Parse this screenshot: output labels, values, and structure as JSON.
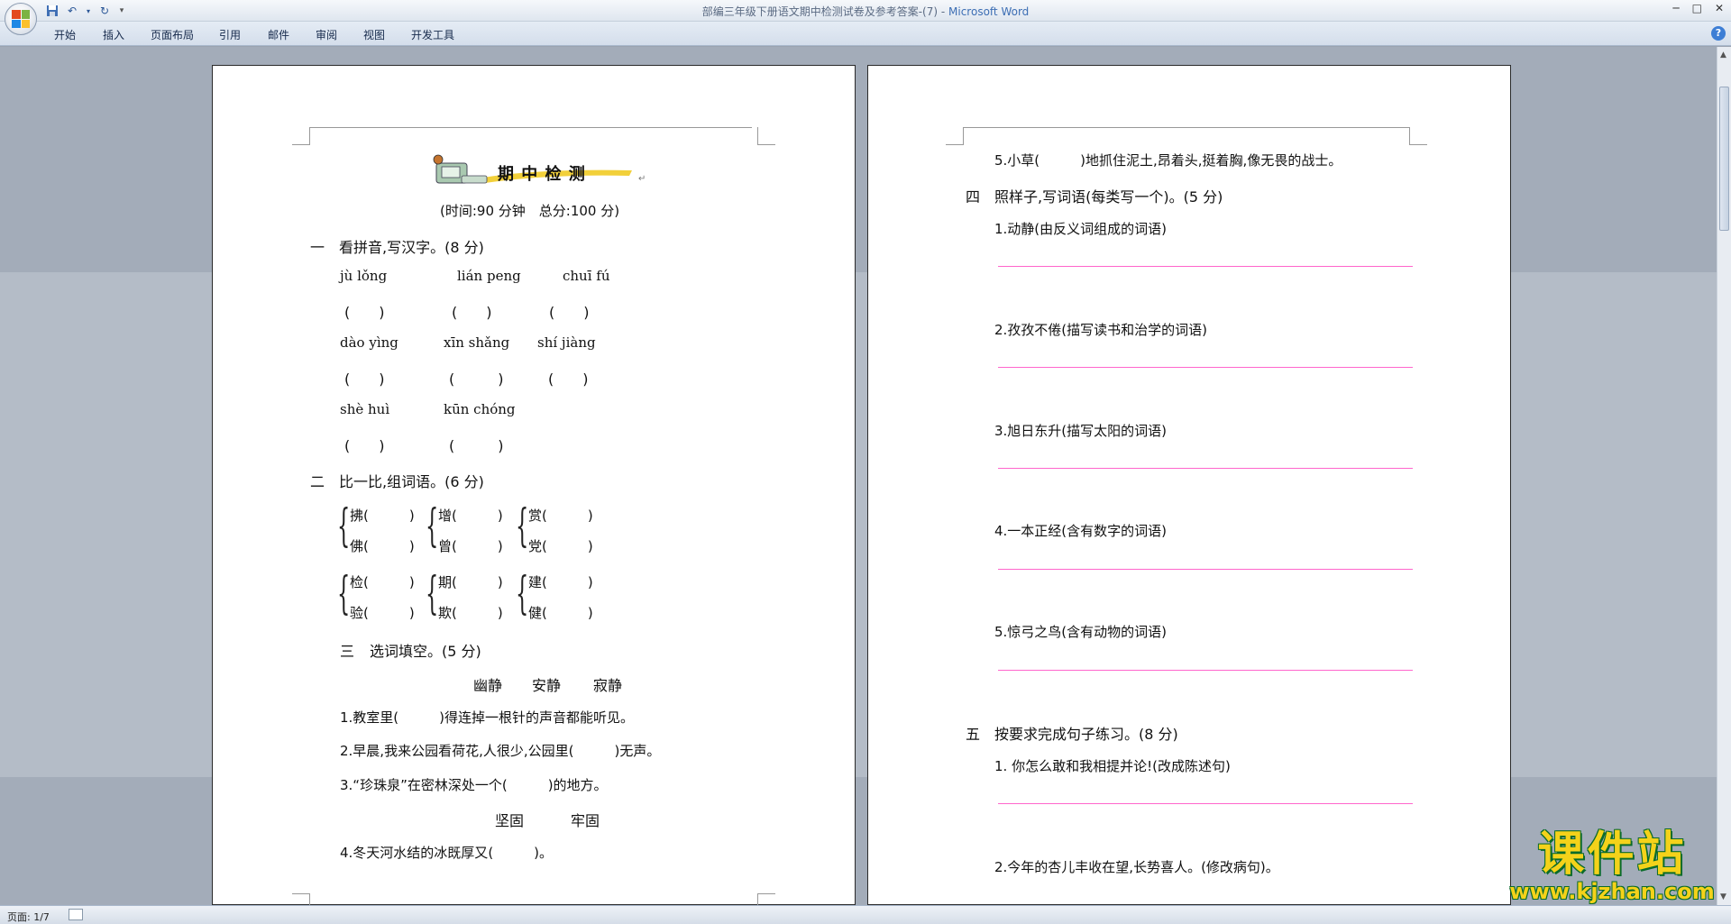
{
  "window": {
    "title": "部编三年级下册语文期中检测试卷及参考答案-(7)",
    "app": "Microsoft Word",
    "separator": " - "
  },
  "ribbon": {
    "tabs": [
      "开始",
      "插入",
      "页面布局",
      "引用",
      "邮件",
      "审阅",
      "视图",
      "开发工具"
    ],
    "help": "?"
  },
  "status": {
    "page": "页面: 1/7"
  },
  "watermark": {
    "cn": "课件站",
    "url": "www.kjzhan.com"
  },
  "colors": {
    "answer_line": "#ff66cc",
    "watermark": "#f4d21a",
    "watermark_outline": "#0a6b2a"
  },
  "page1": {
    "title": "期 中 检 测",
    "subtitle": "(时间:90 分钟　总分:100 分)",
    "s1": {
      "num": "一",
      "head": "看拼音,写汉字。(8 分)"
    },
    "pinyin_r1": [
      "jù lǒng",
      "lián peng",
      "chuī  fú"
    ],
    "blank_r1": [
      "(　　)",
      "(　　)",
      "(　　)"
    ],
    "pinyin_r2": [
      "dào  yìng",
      "xīn  shǎng",
      "shí jiàng"
    ],
    "blank_r2": [
      "(　　)",
      "(　　　)",
      "(　　)"
    ],
    "pinyin_r3": [
      "shè huì",
      "kūn  chóng"
    ],
    "blank_r3": [
      "(　　)",
      "(　　　)"
    ],
    "s2": {
      "num": "二",
      "head": "比一比,组词语。(6 分)"
    },
    "groups": [
      [
        "拂(　　　)",
        "佛(　　　)"
      ],
      [
        "增(　　　)",
        "曾(　　　)"
      ],
      [
        "赏(　　　)",
        "党(　　　)"
      ],
      [
        "检(　　　)",
        "验(　　　)"
      ],
      [
        "期(　　　)",
        "欺(　　　)"
      ],
      [
        "建(　　　)",
        "健(　　　)"
      ]
    ],
    "s3": {
      "num": "三",
      "head": "选词填空。(5 分)"
    },
    "words1": [
      "幽静",
      "安静",
      "寂静"
    ],
    "q1": "1.教室里(　　　)得连掉一根针的声音都能听见。",
    "q2": "2.早晨,我来公园看荷花,人很少,公园里(　　　)无声。",
    "q3": "3.“珍珠泉”在密林深处一个(　　　)的地方。",
    "words2": [
      "坚固",
      "牢固"
    ],
    "q4": "4.冬天河水结的冰既厚又(　　　)。"
  },
  "page2": {
    "q5": "5.小草(　　　)地抓住泥土,昂着头,挺着胸,像无畏的战士。",
    "s4": {
      "num": "四",
      "head": "照样子,写词语(每类写一个)。(5 分)"
    },
    "items4": [
      "1.动静(由反义词组成的词语)",
      "2.孜孜不倦(描写读书和治学的词语)",
      "3.旭日东升(描写太阳的词语)",
      "4.一本正经(含有数字的词语)",
      "5.惊弓之鸟(含有动物的词语)"
    ],
    "s5": {
      "num": "五",
      "head": "按要求完成句子练习。(8 分)"
    },
    "items5": [
      "1.  你怎么敢和我相提并论!(改成陈述句)",
      "2.今年的杏儿丰收在望,长势喜人。(修改病句)。"
    ]
  }
}
